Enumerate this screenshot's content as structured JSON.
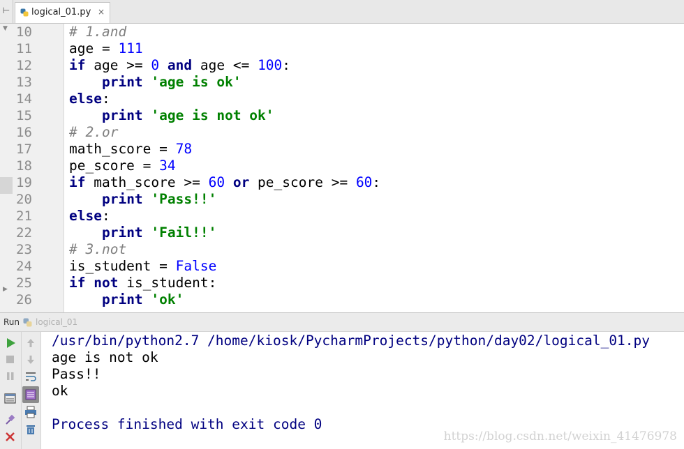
{
  "tab": {
    "file_name": "logical_01.py",
    "close_glyph": "×",
    "icon": "python-file-icon"
  },
  "nav_glyph": "⊢",
  "editor": {
    "line_numbers": [
      "10",
      "11",
      "12",
      "13",
      "14",
      "15",
      "16",
      "17",
      "18",
      "19",
      "20",
      "21",
      "22",
      "23",
      "24",
      "25",
      "26"
    ],
    "lines": [
      [
        {
          "t": "# 1.and",
          "c": "cmt"
        }
      ],
      [
        {
          "t": "age = ",
          "c": ""
        },
        {
          "t": "111",
          "c": "num"
        }
      ],
      [
        {
          "t": "if",
          "c": "kw"
        },
        {
          "t": " age >= ",
          "c": ""
        },
        {
          "t": "0",
          "c": "num"
        },
        {
          "t": " ",
          "c": ""
        },
        {
          "t": "and",
          "c": "kw"
        },
        {
          "t": " age <= ",
          "c": ""
        },
        {
          "t": "100",
          "c": "num"
        },
        {
          "t": ":",
          "c": ""
        }
      ],
      [
        {
          "t": "    ",
          "c": ""
        },
        {
          "t": "print",
          "c": "kw"
        },
        {
          "t": " ",
          "c": ""
        },
        {
          "t": "'age is ok'",
          "c": "str"
        }
      ],
      [
        {
          "t": "else",
          "c": "kw"
        },
        {
          "t": ":",
          "c": ""
        }
      ],
      [
        {
          "t": "    ",
          "c": ""
        },
        {
          "t": "print",
          "c": "kw"
        },
        {
          "t": " ",
          "c": ""
        },
        {
          "t": "'age is not ok'",
          "c": "str"
        }
      ],
      [
        {
          "t": "# 2.or",
          "c": "cmt"
        }
      ],
      [
        {
          "t": "math_score = ",
          "c": ""
        },
        {
          "t": "78",
          "c": "num"
        }
      ],
      [
        {
          "t": "pe_score = ",
          "c": ""
        },
        {
          "t": "34",
          "c": "num"
        }
      ],
      [
        {
          "t": "if",
          "c": "kw"
        },
        {
          "t": " math_score >= ",
          "c": ""
        },
        {
          "t": "60",
          "c": "num"
        },
        {
          "t": " ",
          "c": ""
        },
        {
          "t": "or",
          "c": "kw"
        },
        {
          "t": " pe_score >= ",
          "c": ""
        },
        {
          "t": "60",
          "c": "num"
        },
        {
          "t": ":",
          "c": ""
        }
      ],
      [
        {
          "t": "    ",
          "c": ""
        },
        {
          "t": "print",
          "c": "kw"
        },
        {
          "t": " ",
          "c": ""
        },
        {
          "t": "'Pass!!'",
          "c": "str"
        }
      ],
      [
        {
          "t": "else",
          "c": "kw"
        },
        {
          "t": ":",
          "c": ""
        }
      ],
      [
        {
          "t": "    ",
          "c": ""
        },
        {
          "t": "print",
          "c": "kw"
        },
        {
          "t": " ",
          "c": ""
        },
        {
          "t": "'Fail!!'",
          "c": "str"
        }
      ],
      [
        {
          "t": "# 3.not",
          "c": "cmt"
        }
      ],
      [
        {
          "t": "is_student = ",
          "c": ""
        },
        {
          "t": "False",
          "c": "num"
        }
      ],
      [
        {
          "t": "if",
          "c": "kw"
        },
        {
          "t": " ",
          "c": ""
        },
        {
          "t": "not",
          "c": "kw"
        },
        {
          "t": " is_student:",
          "c": ""
        }
      ],
      [
        {
          "t": "    ",
          "c": ""
        },
        {
          "t": "print",
          "c": "kw"
        },
        {
          "t": " ",
          "c": ""
        },
        {
          "t": "'ok'",
          "c": "str"
        }
      ]
    ]
  },
  "run": {
    "label": "Run",
    "config_name": "logical_01",
    "console_lines": [
      {
        "text": "/usr/bin/python2.7 /home/kiosk/PycharmProjects/python/day02/logical_01.py",
        "kind": "cmd"
      },
      {
        "text": "age is not ok",
        "kind": "out"
      },
      {
        "text": "Pass!!",
        "kind": "out"
      },
      {
        "text": "ok",
        "kind": "out"
      },
      {
        "text": "",
        "kind": "out"
      },
      {
        "text": "Process finished with exit code 0",
        "kind": "fin"
      }
    ],
    "toolbar": [
      "run-icon",
      "stop-icon",
      "pause-icon",
      "layout-icon",
      "pin-icon",
      "close-icon"
    ],
    "toolbar2": [
      "up-arrow-icon",
      "down-arrow-icon",
      "soft-wrap-icon",
      "scroll-to-end-icon",
      "print-icon",
      "trash-icon"
    ]
  },
  "watermark": "https://blog.csdn.net/weixin_41476978",
  "colors": {
    "keyword": "#000080",
    "number": "#0000ff",
    "string": "#008000",
    "comment": "#808080",
    "run_green": "#3ea23e",
    "stop_red": "#cc3333"
  }
}
